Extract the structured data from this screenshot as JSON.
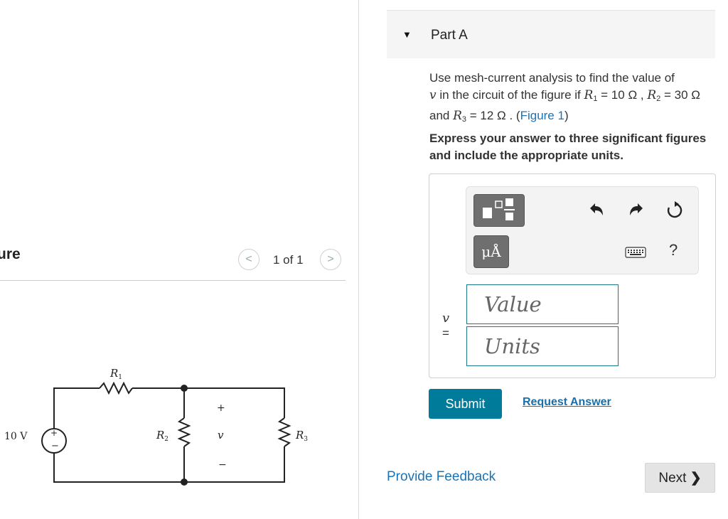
{
  "figure": {
    "title_fragment": "ure",
    "counter": "1 of 1",
    "prev_glyph": "<",
    "next_glyph": ">",
    "circuit": {
      "source_label": "10 V",
      "source_plus": "+",
      "source_minus": "−",
      "r1": "R",
      "r1_sub": "1",
      "r2": "R",
      "r2_sub": "2",
      "r3": "R",
      "r3_sub": "3",
      "v_plus": "+",
      "v_label": "v",
      "v_minus": "−"
    }
  },
  "part": {
    "arrow": "▼",
    "title": "Part A"
  },
  "question": {
    "t1": "Use mesh-current analysis to find the value of",
    "v": "v",
    "t2": " in the circuit of the figure if ",
    "r1": "R",
    "r1_sub": "1",
    "r1_val": " = 10 Ω , ",
    "r2": "R",
    "r2_sub": "2",
    "r2_val": " = 30 Ω",
    "and": " and ",
    "r3": "R",
    "r3_sub": "3",
    "r3_val": " = 12 Ω . (",
    "fig_link": "Figure 1",
    "close": ")"
  },
  "instruction": "Express your answer to three significant figures and include the appropriate units.",
  "answer": {
    "var_label": "v",
    "equals": "=",
    "value_placeholder": "Value",
    "units_placeholder": "Units",
    "units_button": "μÅ",
    "help": "?"
  },
  "actions": {
    "submit": "Submit",
    "request_answer": "Request Answer",
    "feedback": "Provide Feedback",
    "next": "Next",
    "next_glyph": "❯"
  }
}
